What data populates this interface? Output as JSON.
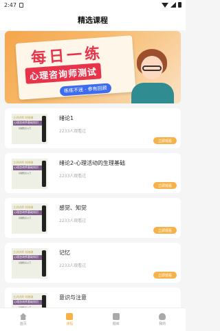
{
  "status": {
    "time": "2:47"
  },
  "header": {
    "title": "精选课程"
  },
  "banner": {
    "title": "每日一练",
    "subtitle": "心理咨询师测试",
    "tag": "练练不迷 · 参有回顾"
  },
  "courses": [
    {
      "thumb_top": "主讲讲师 刘晓琳",
      "thumb_name": "心理咨询师基础知识",
      "thumb_sub": "基础知识入门",
      "title": "绪论1",
      "views": "2233人观看过",
      "button": "立即观看"
    },
    {
      "thumb_top": "主讲讲师 刘晓琳",
      "thumb_name": "心理咨询师基础知识",
      "thumb_sub": "基础知识入门",
      "title": "绪论2-心理活动的生理基础",
      "views": "2233人观看过",
      "button": "立即观看"
    },
    {
      "thumb_top": "主讲讲师 刘晓琳",
      "thumb_name": "心理咨询师基础知识",
      "thumb_sub": "基础知识入门",
      "title": "感觉、知觉",
      "views": "2233人观看过",
      "button": "立即观看"
    },
    {
      "thumb_top": "主讲讲师 刘晓琳",
      "thumb_name": "心理咨询师基础知识",
      "thumb_sub": "基础知识入门",
      "title": "记忆",
      "views": "2233人观看过",
      "button": "立即观看"
    },
    {
      "thumb_top": "主讲讲师 刘晓琳",
      "thumb_name": "心理咨询师基础知识",
      "thumb_sub": "基础知识入门",
      "title": "意识与注意",
      "views": "",
      "button": ""
    }
  ],
  "tabs": [
    {
      "label": "首页",
      "icon": "home-icon",
      "active": false
    },
    {
      "label": "课程",
      "icon": "course-icon",
      "active": true
    },
    {
      "label": "题库",
      "icon": "document-icon",
      "active": false
    },
    {
      "label": "我的",
      "icon": "person-icon",
      "active": false
    }
  ],
  "colors": {
    "accent": "#f7b149",
    "banner_red": "#e8344a"
  }
}
